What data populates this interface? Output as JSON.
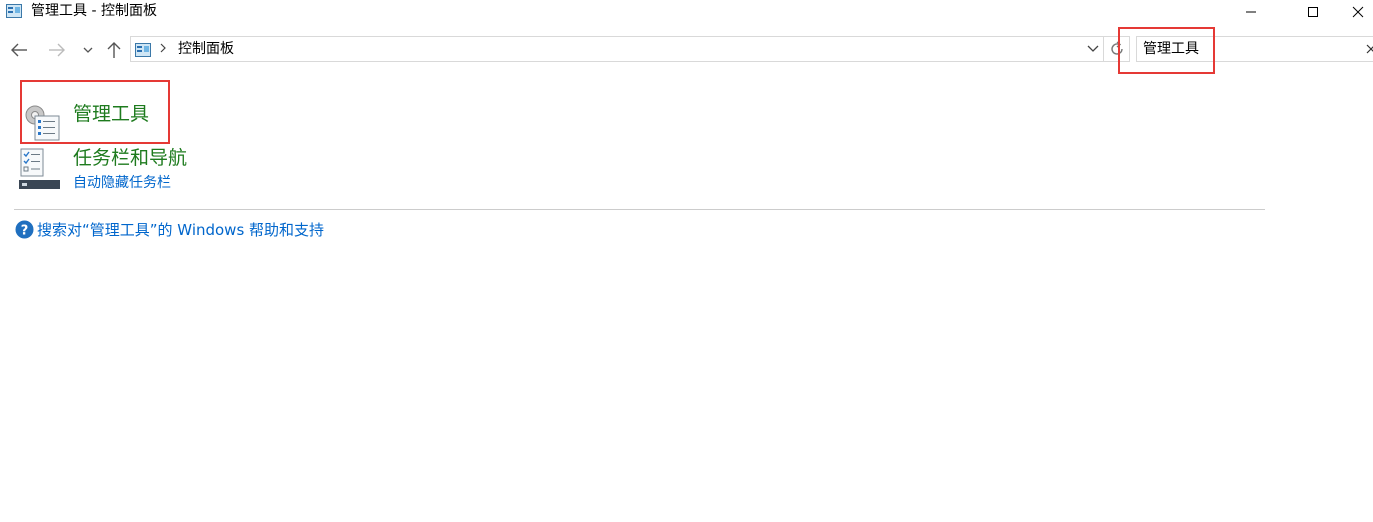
{
  "window": {
    "title": "管理工具 - 控制面板",
    "icon": "control-panel-icon"
  },
  "nav": {
    "back_icon": "back-arrow-icon",
    "forward_icon": "forward-arrow-icon",
    "recent_icon": "chevron-down-icon",
    "up_icon": "up-arrow-icon"
  },
  "address": {
    "path": "控制面板"
  },
  "search": {
    "value": "管理工具"
  },
  "results": [
    {
      "title": "管理工具",
      "links": []
    },
    {
      "title": "任务栏和导航",
      "links": [
        "自动隐藏任务栏"
      ]
    }
  ],
  "help": {
    "link_text": "搜索对“管理工具”的 Windows 帮助和支持"
  },
  "colors": {
    "result_title": "#1e7b1e",
    "link": "#0066cc",
    "highlight": "#e53935"
  }
}
